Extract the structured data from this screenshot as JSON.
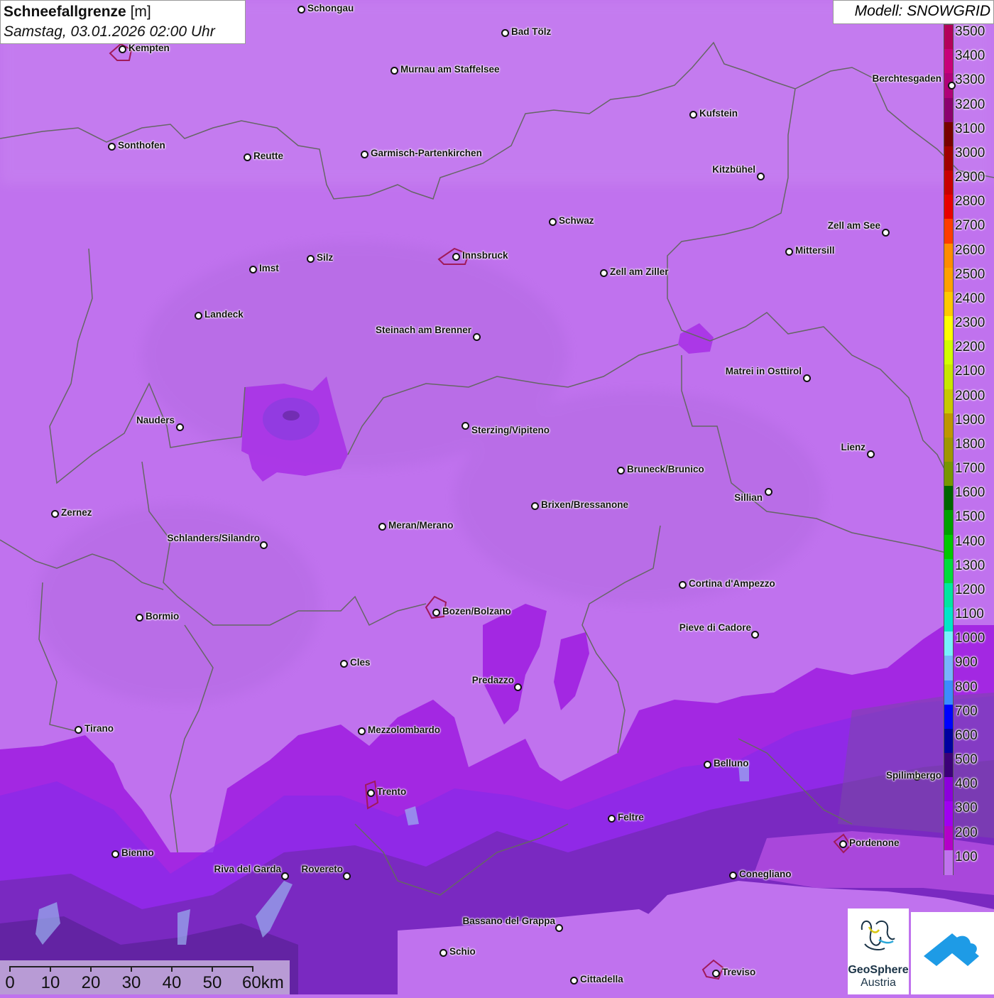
{
  "header": {
    "title_bold": "Schneefallgrenze",
    "title_unit": "[m]",
    "datetime": "Samstag, 03.01.2026 02:00 Uhr"
  },
  "model_label": "Modell: SNOWGRID",
  "legend": {
    "labels": [
      "3500",
      "3400",
      "3300",
      "3200",
      "3100",
      "3000",
      "2900",
      "2800",
      "2700",
      "2600",
      "2500",
      "2400",
      "2300",
      "2200",
      "2100",
      "2000",
      "1900",
      "1800",
      "1700",
      "1600",
      "1500",
      "1400",
      "1300",
      "1200",
      "1100",
      "1000",
      "900",
      "800",
      "700",
      "600",
      "500",
      "400",
      "300",
      "200",
      "100"
    ],
    "colors": [
      "#b4005a",
      "#c8007a",
      "#b00078",
      "#8c006e",
      "#780000",
      "#a00000",
      "#c80000",
      "#e80000",
      "#ff3c00",
      "#ff8c00",
      "#ffa000",
      "#ffc800",
      "#ffff00",
      "#d2ff00",
      "#c8e600",
      "#c8c800",
      "#be9600",
      "#a09600",
      "#789600",
      "#006400",
      "#00a000",
      "#00c800",
      "#00dc3c",
      "#00e6a0",
      "#00e6c8",
      "#78f0ff",
      "#78b4ff",
      "#3c8cff",
      "#0000ff",
      "#0000a0",
      "#3c0078",
      "#8c00dc",
      "#a000f0",
      "#b400c8",
      "#c072ee"
    ]
  },
  "map": {
    "cities": [
      {
        "name": "Schongau"
      },
      {
        "name": "Bad Tölz"
      },
      {
        "name": "Kempten"
      },
      {
        "name": "Murnau am Staffelsee"
      },
      {
        "name": "Berchtesgaden"
      },
      {
        "name": "Kufstein"
      },
      {
        "name": "Sonthofen"
      },
      {
        "name": "Reutte"
      },
      {
        "name": "Garmisch-Partenkirchen"
      },
      {
        "name": "Kitzbühel"
      },
      {
        "name": "Schwaz"
      },
      {
        "name": "Zell am See"
      },
      {
        "name": "Imst"
      },
      {
        "name": "Silz"
      },
      {
        "name": "Innsbruck"
      },
      {
        "name": "Mittersill"
      },
      {
        "name": "Zell am Ziller"
      },
      {
        "name": "Landeck"
      },
      {
        "name": "Steinach am Brenner"
      },
      {
        "name": "Matrei in Osttirol"
      },
      {
        "name": "Nauders"
      },
      {
        "name": "Sterzing/Vipiteno"
      },
      {
        "name": "Lienz"
      },
      {
        "name": "Bruneck/Brunico"
      },
      {
        "name": "Sillian"
      },
      {
        "name": "Zernez"
      },
      {
        "name": "Brixen/Bressanone"
      },
      {
        "name": "Meran/Merano"
      },
      {
        "name": "Schlanders/Silandro"
      },
      {
        "name": "Cortina d'Ampezzo"
      },
      {
        "name": "Bozen/Bolzano"
      },
      {
        "name": "Bormio"
      },
      {
        "name": "Pieve di Cadore"
      },
      {
        "name": "Cles"
      },
      {
        "name": "Predazzo"
      },
      {
        "name": "Tirano"
      },
      {
        "name": "Mezzolombardo"
      },
      {
        "name": "Belluno"
      },
      {
        "name": "Spilimbergo"
      },
      {
        "name": "Trento"
      },
      {
        "name": "Feltre"
      },
      {
        "name": "Pordenone"
      },
      {
        "name": "Bienno"
      },
      {
        "name": "Riva del Garda"
      },
      {
        "name": "Rovereto"
      },
      {
        "name": "Conegliano"
      },
      {
        "name": "Bassano del Grappa"
      },
      {
        "name": "Schio"
      },
      {
        "name": "Treviso"
      },
      {
        "name": "Cittadella"
      }
    ]
  },
  "scalebar": {
    "labels": [
      "0",
      "10",
      "20",
      "30",
      "40",
      "50",
      "60km"
    ]
  },
  "logos": {
    "geosphere_line1": "GeoSphere",
    "geosphere_line2": "Austria"
  }
}
